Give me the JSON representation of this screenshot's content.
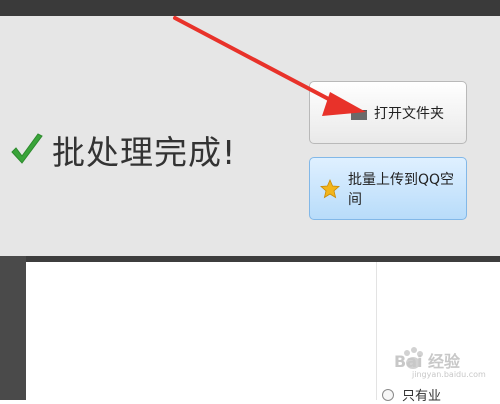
{
  "status": {
    "message": "批处理完成!"
  },
  "buttons": {
    "open_folder": {
      "label": "打开文件夹",
      "icon": "folder-icon"
    },
    "batch_upload": {
      "label": "批量上传到QQ空间",
      "icon": "star-icon"
    }
  },
  "options": {
    "radio_label": "只有业"
  },
  "watermark": {
    "text": "Bai 经验",
    "url": "jingyan.baidu.com"
  },
  "colors": {
    "accent_arrow": "#e8322a",
    "check_green": "#3aa43a",
    "upload_button": "#b8dcfa"
  }
}
